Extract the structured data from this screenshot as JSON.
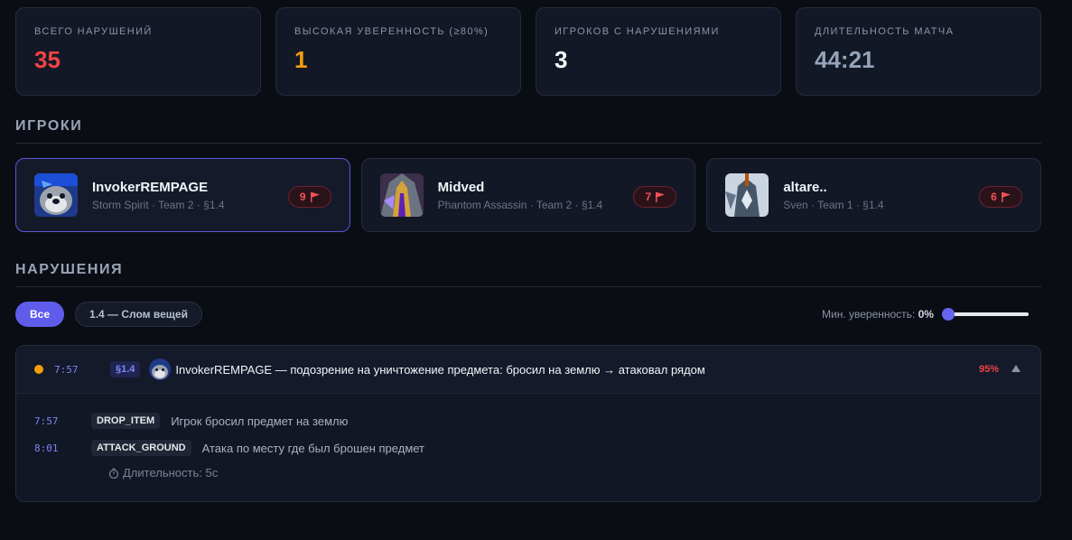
{
  "stats": [
    {
      "label": "ВСЕГО НАРУШЕНИЙ",
      "value": "35",
      "color": "#ef4444"
    },
    {
      "label": "ВЫСОКАЯ УВЕРЕННОСТЬ (≥80%)",
      "value": "1",
      "color": "#f59e0b"
    },
    {
      "label": "ИГРОКОВ С НАРУШЕНИЯМИ",
      "value": "3",
      "color": "#f8fafc"
    },
    {
      "label": "ДЛИТЕЛЬНОСТЬ МАТЧА",
      "value": "44:21",
      "color": "#94a3b8"
    }
  ],
  "players_section": {
    "title": "ИГРОКИ"
  },
  "players": [
    {
      "name": "InvokerREMPAGE",
      "meta": "Storm Spirit · Team 2 · §1.4",
      "count": "9",
      "avatar_icon": "storm-spirit-portrait",
      "active": true
    },
    {
      "name": "Midved",
      "meta": "Phantom Assassin · Team 2 · §1.4",
      "count": "7",
      "avatar_icon": "phantom-assassin-portrait",
      "active": false
    },
    {
      "name": "altare..",
      "meta": "Sven · Team 1 · §1.4",
      "count": "6",
      "avatar_icon": "sven-portrait",
      "active": false
    }
  ],
  "violations_section": {
    "title": "НАРУШЕНИЯ"
  },
  "filters": [
    {
      "label": "Все",
      "active": true
    },
    {
      "label": "1.4 — Слом вещей",
      "active": false
    }
  ],
  "confidence": {
    "label": "Мин. уверенность: ",
    "value": "0%",
    "fraction": 0
  },
  "violation": {
    "time": "7:57",
    "section": "§1.4",
    "text": "InvokerREMPAGE — подозрение на уничтожение предмета: бросил на землю → атаковал рядом",
    "confidence": "95%",
    "status_color": "#f59e0b",
    "expanded": true,
    "events": [
      {
        "time": "7:57",
        "type": "DROP_ITEM",
        "desc": "Игрок бросил предмет на землю"
      },
      {
        "time": "8:01",
        "type": "ATTACK_GROUND",
        "desc": "Атака по месту где был брошен предмет"
      }
    ],
    "duration": "Длительность: 5с"
  },
  "colors": {
    "accent": "#6366f1",
    "danger": "#ef4444",
    "warning": "#f59e0b"
  }
}
